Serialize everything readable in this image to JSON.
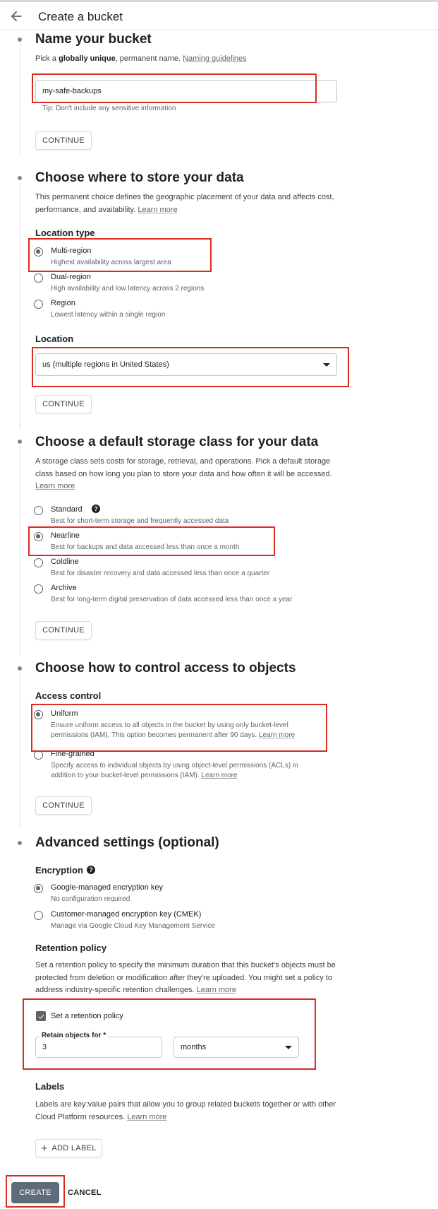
{
  "header": {
    "title": "Create a bucket"
  },
  "name_section": {
    "title": "Name your bucket",
    "desc_prefix": "Pick a ",
    "desc_bold": "globally unique",
    "desc_suffix": ", permanent name.",
    "link": "Naming guidelines",
    "bucket_name": "my-safe-backups",
    "tip": "Tip: Don't include any sensitive information",
    "continue": "CONTINUE"
  },
  "location_section": {
    "title": "Choose where to store your data",
    "desc": "This permanent choice defines the geographic placement of your data and affects cost, performance, and availability.",
    "link": "Learn more",
    "type_heading": "Location type",
    "options": [
      {
        "label": "Multi-region",
        "desc": "Highest availability across largest area",
        "selected": true
      },
      {
        "label": "Dual-region",
        "desc": "High availability and low latency across 2 regions",
        "selected": false
      },
      {
        "label": "Region",
        "desc": "Lowest latency within a single region",
        "selected": false
      }
    ],
    "location_heading": "Location",
    "location_value": "us (multiple regions in United States)",
    "continue": "CONTINUE"
  },
  "storage_section": {
    "title": "Choose a default storage class for your data",
    "desc": "A storage class sets costs for storage, retrieval, and operations. Pick a default storage class based on how long you plan to store your data and how often it will be accessed.",
    "link": "Learn more",
    "options": [
      {
        "label": "Standard",
        "desc": "Best for short-term storage and frequently accessed data",
        "selected": false
      },
      {
        "label": "Nearline",
        "desc": "Best for backups and data accessed less than once a month",
        "selected": true
      },
      {
        "label": "Coldline",
        "desc": "Best for disaster recovery and data accessed less than once a quarter",
        "selected": false
      },
      {
        "label": "Archive",
        "desc": "Best for long-term digital preservation of data accessed less than once a year",
        "selected": false
      }
    ],
    "continue": "CONTINUE"
  },
  "access_section": {
    "title": "Choose how to control access to objects",
    "heading": "Access control",
    "options": [
      {
        "label": "Uniform",
        "desc": "Ensure uniform access to all objects in the bucket by using only bucket-level permissions (IAM). This option becomes permanent after 90 days.",
        "link": "Learn more",
        "selected": true
      },
      {
        "label": "Fine-grained",
        "desc": "Specify access to individual objects by using object-level permissions (ACLs) in addition to your bucket-level permissions (IAM).",
        "link": "Learn more",
        "selected": false
      }
    ],
    "continue": "CONTINUE"
  },
  "advanced_section": {
    "title": "Advanced settings (optional)",
    "encryption_heading": "Encryption",
    "encryption_options": [
      {
        "label": "Google-managed encryption key",
        "desc": "No configuration required",
        "selected": true
      },
      {
        "label": "Customer-managed encryption key (CMEK)",
        "desc": "Manage via Google Cloud Key Management Service",
        "selected": false
      }
    ],
    "retention_heading": "Retention policy",
    "retention_desc": "Set a retention policy to specify the minimum duration that this bucket's objects must be protected from deletion or modification after they're uploaded. You might set a policy to address industry-specific retention challenges.",
    "retention_link": "Learn more",
    "retention_checkbox": "Set a retention policy",
    "retention_checked": true,
    "retain_label": "Retain objects for *",
    "retain_value": "3",
    "retain_unit": "months",
    "labels_heading": "Labels",
    "labels_desc": "Labels are key:value pairs that allow you to group related buckets together or with other Cloud Platform resources.",
    "labels_link": "Learn more",
    "add_label": "ADD LABEL"
  },
  "footer": {
    "create": "CREATE",
    "cancel": "CANCEL"
  },
  "colors": {
    "highlight": "#d92d20",
    "create_bg": "#5f6b78",
    "muted": "#5f6368"
  }
}
